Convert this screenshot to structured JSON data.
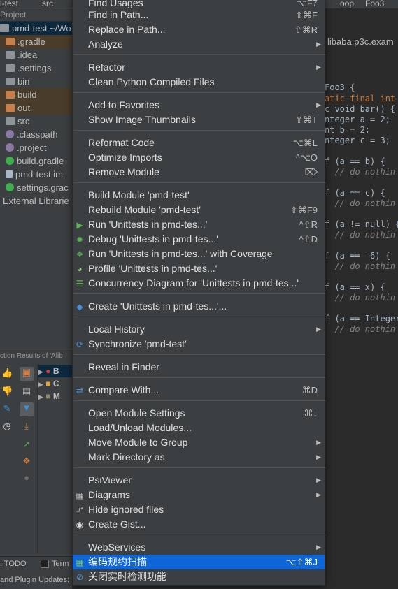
{
  "topbar": {
    "project_crumb": "l-test",
    "src_crumb": "src",
    "tab1": "oop",
    "tab2": "Foo3"
  },
  "project_panel": {
    "header": "Project",
    "root": "pmd-test  ~/Wo",
    "items": [
      {
        "label": ".gradle",
        "icon": "folder-orange-icon"
      },
      {
        "label": ".idea",
        "icon": "folder-icon"
      },
      {
        "label": ".settings",
        "icon": "folder-icon"
      },
      {
        "label": "bin",
        "icon": "folder-icon"
      },
      {
        "label": "build",
        "icon": "folder-orange-icon"
      },
      {
        "label": "out",
        "icon": "folder-orange-icon"
      },
      {
        "label": "src",
        "icon": "folder-icon"
      },
      {
        "label": ".classpath",
        "icon": "file-icon"
      },
      {
        "label": ".project",
        "icon": "file-icon"
      },
      {
        "label": "build.gradle",
        "icon": "gradle-icon"
      },
      {
        "label": "pmd-test.im",
        "icon": "file-icon"
      },
      {
        "label": "settings.grac",
        "icon": "gradle-icon"
      },
      {
        "label": "External Librarie",
        "icon": "library-icon"
      }
    ]
  },
  "results_panel": {
    "header": "ction Results of 'Alib",
    "rows": [
      "B",
      "C",
      "M"
    ]
  },
  "statusbar": {
    "todo": ": TODO",
    "terminal": "Term",
    "updates": "and Plugin Updates:"
  },
  "editor": {
    "crumb": "libaba.p3c.exam",
    "lines": [
      "Foo3 {",
      "atic final int",
      "c void bar() {",
      "nteger a = 2;",
      "nt b = 2;",
      "nteger c = 3;",
      "f (a == b) {",
      "  // do nothin",
      "f (a == c) {",
      "  // do nothin",
      "f (a != null) {",
      "  // do nothin",
      "f (a == -6) {",
      "  // do nothin",
      "f (a == x) {",
      "  // do nothin",
      "f (a == Integer",
      "  // do nothin"
    ]
  },
  "menu": {
    "items": [
      {
        "label": "Find Usages",
        "shortcut": "⌥F7"
      },
      {
        "label": "Find in Path...",
        "shortcut": "⇧⌘F"
      },
      {
        "label": "Replace in Path...",
        "shortcut": "⇧⌘R"
      },
      {
        "label": "Analyze",
        "submenu": true
      },
      {
        "label": "Refactor",
        "submenu": true
      },
      {
        "label": "Clean Python Compiled Files"
      },
      {
        "label": "Add to Favorites",
        "submenu": true
      },
      {
        "label": "Show Image Thumbnails",
        "shortcut": "⇧⌘T"
      },
      {
        "label": "Reformat Code",
        "shortcut": "⌥⌘L"
      },
      {
        "label": "Optimize Imports",
        "shortcut": "^⌥O"
      },
      {
        "label": "Remove Module",
        "shortcut": "⌦"
      },
      {
        "label": "Build Module 'pmd-test'"
      },
      {
        "label": "Rebuild Module 'pmd-test'",
        "shortcut": "⇧⌘F9"
      },
      {
        "label": "Run 'Unittests in pmd-tes...'",
        "shortcut": "^⇧R",
        "icon": "run-icon"
      },
      {
        "label": "Debug 'Unittests in pmd-tes...'",
        "shortcut": "^⇧D",
        "icon": "debug-icon"
      },
      {
        "label": "Run 'Unittests in pmd-tes...' with Coverage",
        "icon": "coverage-icon"
      },
      {
        "label": "Profile 'Unittests in pmd-tes...'",
        "icon": "profile-icon"
      },
      {
        "label": "Concurrency Diagram for 'Unittests in pmd-tes...'",
        "icon": "concurrency-icon"
      },
      {
        "label": "Create 'Unittests in pmd-tes...'...",
        "icon": "python-icon"
      },
      {
        "label": "Local History",
        "submenu": true
      },
      {
        "label": "Synchronize 'pmd-test'",
        "icon": "sync-icon"
      },
      {
        "label": "Reveal in Finder"
      },
      {
        "label": "Compare With...",
        "shortcut": "⌘D",
        "icon": "compare-icon"
      },
      {
        "label": "Open Module Settings",
        "shortcut": "⌘↓"
      },
      {
        "label": "Load/Unload Modules..."
      },
      {
        "label": "Move Module to Group",
        "submenu": true
      },
      {
        "label": "Mark Directory as",
        "submenu": true
      },
      {
        "label": "PsiViewer",
        "submenu": true
      },
      {
        "label": "Diagrams",
        "submenu": true,
        "icon": "diagram-icon"
      },
      {
        "label": "Hide ignored files",
        "icon": "ignored-files-icon"
      },
      {
        "label": "Create Gist...",
        "icon": "github-icon"
      },
      {
        "label": "WebServices",
        "submenu": true
      },
      {
        "label": "编码规约扫描",
        "shortcut": "⌥⇧⌘J",
        "icon": "scan-icon"
      },
      {
        "label": "关闭实时检测功能",
        "icon": "disable-icon"
      }
    ],
    "highlight_color": "#0d65d7",
    "background_color": "#3c3f41"
  }
}
